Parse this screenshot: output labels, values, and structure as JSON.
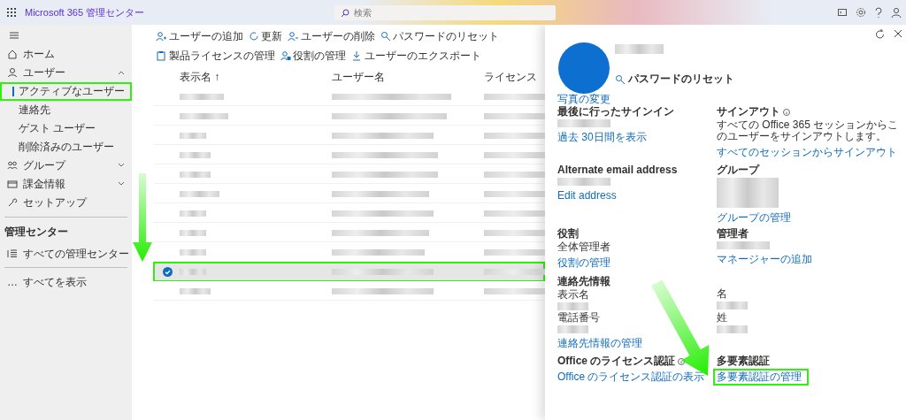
{
  "topbar": {
    "title": "Microsoft 365 管理センター",
    "search": {
      "placeholder": "検索"
    }
  },
  "sidebar": {
    "items": [
      {
        "label": "ホーム"
      },
      {
        "label": "ユーザー",
        "expanded": true,
        "children": [
          {
            "label": "アクティブなユーザー",
            "selected": true,
            "highlighted": true
          },
          {
            "label": "連絡先",
            "selected": false,
            "highlighted": false
          },
          {
            "label": "ゲスト ユーザー",
            "selected": false,
            "highlighted": false
          },
          {
            "label": "削除済みのユーザー",
            "selected": false,
            "highlighted": false
          }
        ]
      },
      {
        "label": "グループ",
        "expanded": false
      },
      {
        "label": "課金情報",
        "expanded": false
      },
      {
        "label": "セットアップ"
      }
    ],
    "section_title": "管理センター",
    "section_items": [
      {
        "label": "すべての管理センター"
      }
    ],
    "more": {
      "glyph": "…",
      "label": "すべてを表示"
    }
  },
  "toolbar": [
    "ユーザーの追加",
    "更新",
    "ユーザーの削除",
    "パスワードのリセット",
    "製品ライセンスの管理",
    "役割の管理",
    "ユーザーのエクスポート"
  ],
  "table": {
    "columns": [
      "表示名 ↑",
      "ユーザー名",
      "ライセンス"
    ],
    "rows": [
      {
        "selected": false,
        "highlighted": false
      },
      {
        "selected": false,
        "highlighted": false
      },
      {
        "selected": false,
        "highlighted": false
      },
      {
        "selected": false,
        "highlighted": false
      },
      {
        "selected": false,
        "highlighted": false
      },
      {
        "selected": false,
        "highlighted": false
      },
      {
        "selected": false,
        "highlighted": false
      },
      {
        "selected": false,
        "highlighted": false
      },
      {
        "selected": false,
        "highlighted": false
      },
      {
        "selected": true,
        "highlighted": true,
        "arrow": true
      },
      {
        "selected": false,
        "highlighted": false
      }
    ]
  },
  "panel": {
    "photo_link": "写真の変更",
    "reset_password": "パスワードのリセット",
    "fields": [
      {
        "label": "最後に行ったサインイン",
        "value_redacted": true,
        "link": "過去 30日間を表示"
      },
      {
        "label": "サインアウト",
        "info": true,
        "text": "すべての Office 365 セッションからこのユーザーをサインアウトします。",
        "link": "すべてのセッションからサインアウト"
      },
      {
        "label": "Alternate email address",
        "value_redacted": true,
        "link": "Edit address"
      },
      {
        "label": "グループ",
        "value_redacted": true,
        "link": "グループの管理"
      },
      {
        "label": "役割",
        "value": "全体管理者",
        "link": "役割の管理"
      },
      {
        "label": "管理者",
        "value_redacted": true,
        "link": "マネージャーの追加"
      },
      {
        "label": "連絡先情報",
        "sublabel": "表示名",
        "value_redacted": true
      },
      {
        "sublabel": "名",
        "value_redacted": true
      },
      {
        "sublabel": "電話番号",
        "value_redacted": true,
        "link": "連絡先情報の管理"
      },
      {
        "sublabel": "姓",
        "value_redacted": true
      },
      {
        "label": "Office のライセンス認証",
        "info": true,
        "link": "Office のライセンス認証の表示"
      },
      {
        "label": "多要素認証",
        "link": "多要素認証の管理",
        "highlighted": true,
        "arrow": true
      }
    ]
  }
}
